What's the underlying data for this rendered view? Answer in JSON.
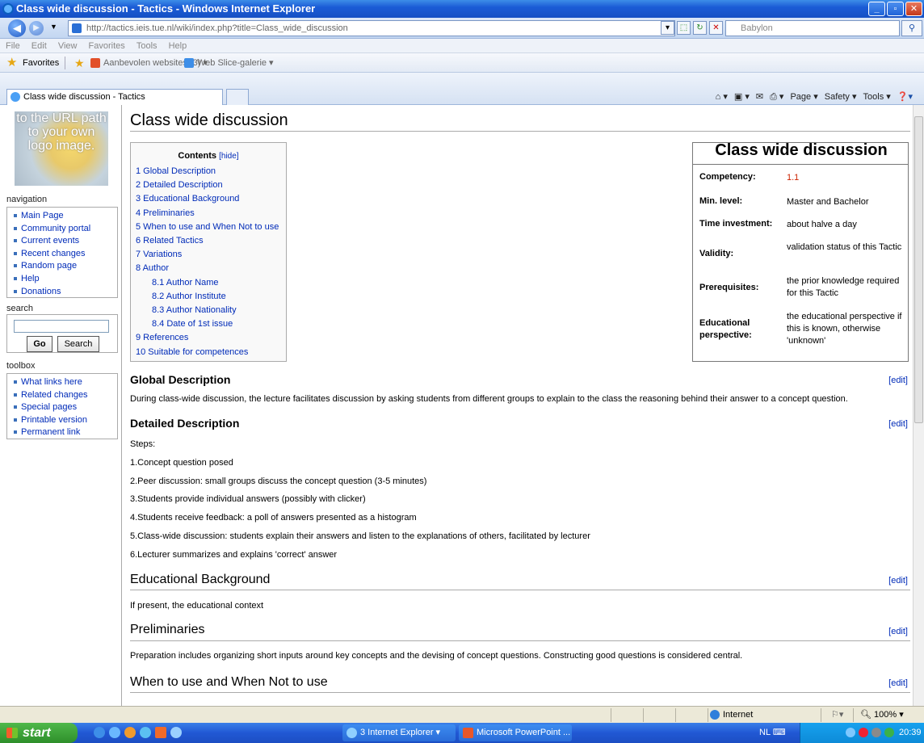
{
  "window": {
    "title": "Class wide discussion - Tactics - Windows Internet Explorer"
  },
  "address": {
    "url": "http://tactics.ieis.tue.nl/wiki/index.php?title=Class_wide_discussion",
    "search_placeholder": "Babylon"
  },
  "menu": [
    "File",
    "Edit",
    "View",
    "Favorites",
    "Tools",
    "Help"
  ],
  "favorites": {
    "label": "Favorites",
    "suggested": "Aanbevolen websites (3) ▾",
    "webslice": "Web Slice-galerie ▾"
  },
  "tab": {
    "label": "Class wide discussion - Tactics"
  },
  "commands": [
    "Page ▾",
    "Safety ▾",
    "Tools ▾"
  ],
  "logo_text": "to the URL path to your own logo image.",
  "sidebar": {
    "navigation_title": "navigation",
    "navigation": [
      "Main Page",
      "Community portal",
      "Current events",
      "Recent changes",
      "Random page",
      "Help",
      "Donations"
    ],
    "search_title": "search",
    "go": "Go",
    "search": "Search",
    "toolbox_title": "toolbox",
    "toolbox": [
      "What links here",
      "Related changes",
      "Special pages",
      "Printable version",
      "Permanent link"
    ]
  },
  "page": {
    "title": "Class wide discussion",
    "toc": {
      "title": "Contents",
      "hide": "[hide]",
      "items": [
        {
          "text": "1 Global Description",
          "sub": false
        },
        {
          "text": "2 Detailed Description",
          "sub": false
        },
        {
          "text": "3 Educational Background",
          "sub": false
        },
        {
          "text": "4 Preliminaries",
          "sub": false
        },
        {
          "text": "5 When to use and When Not to use",
          "sub": false
        },
        {
          "text": "6 Related Tactics",
          "sub": false
        },
        {
          "text": "7 Variations",
          "sub": false
        },
        {
          "text": "8 Author",
          "sub": false
        },
        {
          "text": "8.1 Author Name",
          "sub": true
        },
        {
          "text": "8.2 Author Institute",
          "sub": true
        },
        {
          "text": "8.3 Author Nationality",
          "sub": true
        },
        {
          "text": "8.4 Date of 1st issue",
          "sub": true
        },
        {
          "text": "9 References",
          "sub": false
        },
        {
          "text": "10 Suitable for competences",
          "sub": false
        }
      ]
    },
    "infobox": {
      "title": "Class wide discussion",
      "rows": [
        {
          "label": "Competency:",
          "value": "1.1"
        },
        {
          "label": "Min. level:",
          "value": "Master and Bachelor"
        },
        {
          "label": "Time investment:",
          "value": "about halve a day"
        },
        {
          "label": "Validity:",
          "value": "validation status of this Tactic"
        },
        {
          "label": "Prerequisites:",
          "value": "the prior knowledge required for this Tactic"
        },
        {
          "label": "Educational perspective:",
          "value": "the educational perspective if this is known, otherwise 'unknown'"
        }
      ]
    },
    "edit": "[edit]",
    "global_title": "Global Description",
    "global_text": "During class-wide discussion, the lecture facilitates discussion by asking students from different groups to explain to the class the reasoning behind their answer to a concept question.",
    "detailed_title": "Detailed Description",
    "steps_label": "Steps:",
    "steps": [
      "1.Concept question posed",
      "2.Peer discussion: small groups discuss the concept question (3-5 minutes)",
      "3.Students provide individual answers (possibly with clicker)",
      "4.Students receive feedback: a poll of answers presented as a histogram",
      "5.Class-wide discussion: students explain their answers and listen to the explanations of others, facilitated by lecturer",
      "6.Lecturer summarizes and explains 'correct' answer"
    ],
    "edu_title": "Educational Background",
    "edu_text": "If present, the educational context",
    "prelim_title": "Preliminaries",
    "prelim_text": "Preparation includes organizing short inputs around key concepts and the devising of concept questions. Constructing good questions is considered central.",
    "when_title": "When to use and When Not to use"
  },
  "status": {
    "zone": "Internet",
    "zoom": "100%"
  },
  "taskbar": {
    "start": "start",
    "task1": "3 Internet Explorer",
    "task2": "Microsoft PowerPoint ...",
    "lang": "NL",
    "time": "20:39"
  }
}
